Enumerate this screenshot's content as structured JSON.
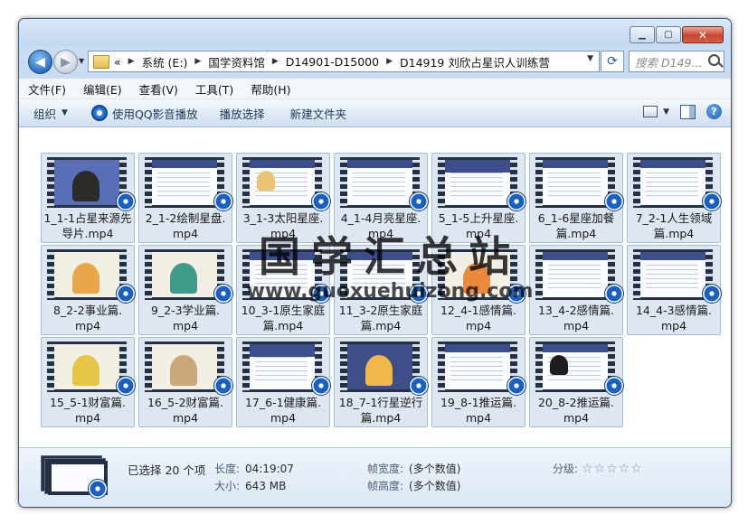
{
  "window": {
    "caption_buttons": [
      "minimize",
      "maximize",
      "close"
    ]
  },
  "address": {
    "root_chevron": "«",
    "crumbs": [
      "系统 (E:)",
      "国学资料馆",
      "D14901-D15000",
      "D14919 刘欣占星识人训练营"
    ],
    "search_placeholder": "搜索 D149..."
  },
  "menu": [
    "文件(F)",
    "编辑(E)",
    "查看(V)",
    "工具(T)",
    "帮助(H)"
  ],
  "toolbar": {
    "organize": "组织",
    "play_qq": "使用QQ影音播放",
    "play_selection": "播放选择",
    "new_folder": "新建文件夹"
  },
  "files": [
    {
      "line1": "1_1-1占星来源先",
      "line2": "导片.mp4",
      "thumb": "portrait"
    },
    {
      "line1": "2_1-2绘制星盘.",
      "line2": "mp4",
      "thumb": "slide"
    },
    {
      "line1": "3_1-3太阳星座.",
      "line2": "mp4",
      "thumb": "slide-sun"
    },
    {
      "line1": "4_1-4月亮星座.",
      "line2": "mp4",
      "thumb": "slide"
    },
    {
      "line1": "5_1-5上升星座.",
      "line2": "mp4",
      "thumb": "slide-band"
    },
    {
      "line1": "6_1-6星座加餐",
      "line2": "篇.mp4",
      "thumb": "slide-table"
    },
    {
      "line1": "7_2-1人生领域",
      "line2": "篇.mp4",
      "thumb": "slide"
    },
    {
      "line1": "8_2-2事业篇.",
      "line2": "mp4",
      "thumb": "cartoon-blue"
    },
    {
      "line1": "9_2-3学业篇.",
      "line2": "mp4",
      "thumb": "cartoon-teal"
    },
    {
      "line1": "10_3-1原生家庭",
      "line2": "篇.mp4",
      "thumb": "slide"
    },
    {
      "line1": "11_3-2原生家庭",
      "line2": "篇.mp4",
      "thumb": "slide"
    },
    {
      "line1": "12_4-1感情篇.",
      "line2": "mp4",
      "thumb": "cartoon-orange"
    },
    {
      "line1": "13_4-2感情篇.",
      "line2": "mp4",
      "thumb": "slide"
    },
    {
      "line1": "14_4-3感情篇.",
      "line2": "mp4",
      "thumb": "slide"
    },
    {
      "line1": "15_5-1财富篇.",
      "line2": "mp4",
      "thumb": "cartoon-yellow"
    },
    {
      "line1": "16_5-2财富篇.",
      "line2": "mp4",
      "thumb": "cartoon-beige"
    },
    {
      "line1": "17_6-1健康篇.",
      "line2": "mp4",
      "thumb": "slide-band"
    },
    {
      "line1": "18_7-1行星逆行",
      "line2": "篇.mp4",
      "thumb": "cartoon-dark"
    },
    {
      "line1": "19_8-1推运篇.",
      "line2": "mp4",
      "thumb": "slide"
    },
    {
      "line1": "20_8-2推运篇.",
      "line2": "mp4",
      "thumb": "slide-photo"
    }
  ],
  "watermark": {
    "title": "国学汇总站",
    "url": "www.guoxuehuizong.com"
  },
  "details": {
    "selected": "已选择 20 个项",
    "length_label": "长度:",
    "length_value": "04:19:07",
    "size_label": "大小:",
    "size_value": "643 MB",
    "frame_width_label": "帧宽度:",
    "frame_width_value": "(多个数值)",
    "frame_height_label": "帧高度:",
    "frame_height_value": "(多个数值)",
    "rating_label": "分级:",
    "rating_stars": "☆☆☆☆☆"
  },
  "colors": {
    "accent": "#3c4f8c",
    "selection_bg": "#dde6f1",
    "chrome": "#c9dcf2"
  }
}
